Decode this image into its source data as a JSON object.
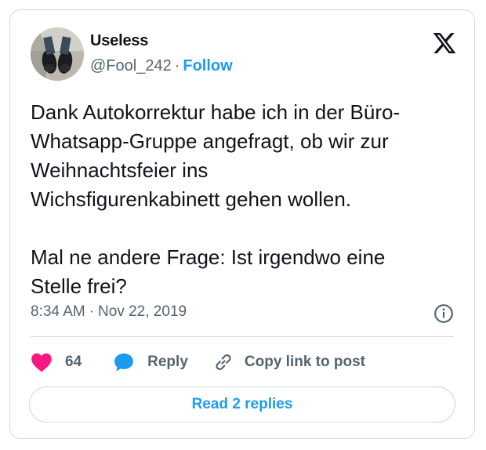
{
  "author": {
    "display_name": "Useless",
    "handle": "@Fool_242",
    "separator": "·",
    "follow_label": "Follow",
    "avatar_icon": "avatar-photo-shoes"
  },
  "platform": {
    "logo_icon": "x-logo-icon"
  },
  "tweet": {
    "text": "Dank Autokorrektur habe ich in der Büro-\nWhatsapp-Gruppe angefragt, ob wir zur\nWeihnachtsfeier ins\nWichsfigurenkabinett gehen wollen.\n\nMal ne andere Frage: Ist irgendwo eine\nStelle frei?",
    "time": "8:34 AM",
    "separator": "·",
    "date": "Nov 22, 2019",
    "info_icon": "info-icon"
  },
  "actions": {
    "like_count": "64",
    "like_icon": "heart-icon",
    "reply_label": "Reply",
    "reply_icon": "speech-bubble-icon",
    "copy_label": "Copy link to post",
    "copy_icon": "link-icon"
  },
  "footer": {
    "read_replies_label": "Read 2 replies"
  },
  "colors": {
    "accent": "#1d9bf0",
    "like": "#f91880",
    "text_primary": "#0f1419",
    "text_secondary": "#536471",
    "border": "#cfd9de"
  }
}
